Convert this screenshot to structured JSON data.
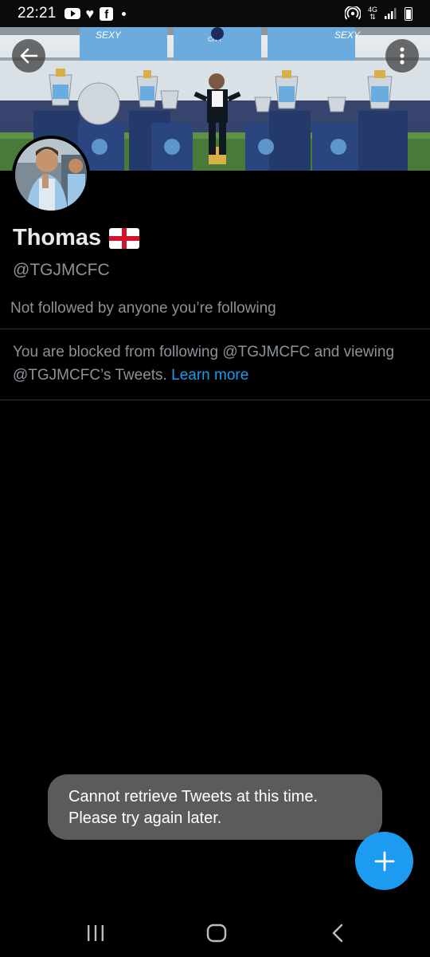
{
  "status_bar": {
    "time": "22:21",
    "network": "4G",
    "icons": [
      "youtube-icon",
      "heart-icon",
      "facebook-icon",
      "dot-icon",
      "hotspot-icon",
      "signal-icon",
      "battery-icon"
    ]
  },
  "banner": {
    "sign_text_left": "SEXY",
    "sign_text_center": "CITY",
    "sign_text_right": "SEXY"
  },
  "header": {
    "back_icon": "arrow-left-icon",
    "more_icon": "more-vertical-icon"
  },
  "profile": {
    "display_name": "Thomas",
    "flag_icon": "england-flag-icon",
    "handle": "@TGJMCFC",
    "followers_note": "Not followed by anyone you’re following",
    "blocked_text": "You are blocked from following @TGJMCFC and viewing @TGJMCFC’s Tweets.",
    "learn_more": "Learn more"
  },
  "toast": {
    "line1": "Cannot retrieve Tweets at this time.",
    "line2": "Please try again later."
  },
  "fab": {
    "icon": "plus-icon"
  },
  "nav_bar": {
    "icons": [
      "recent-apps-icon",
      "home-icon",
      "back-icon"
    ]
  },
  "colors": {
    "background": "#000000",
    "accent": "#1d9bf0",
    "secondary_text": "#8b9298",
    "divider": "#2f3336",
    "toast": "#5b5b5b"
  }
}
